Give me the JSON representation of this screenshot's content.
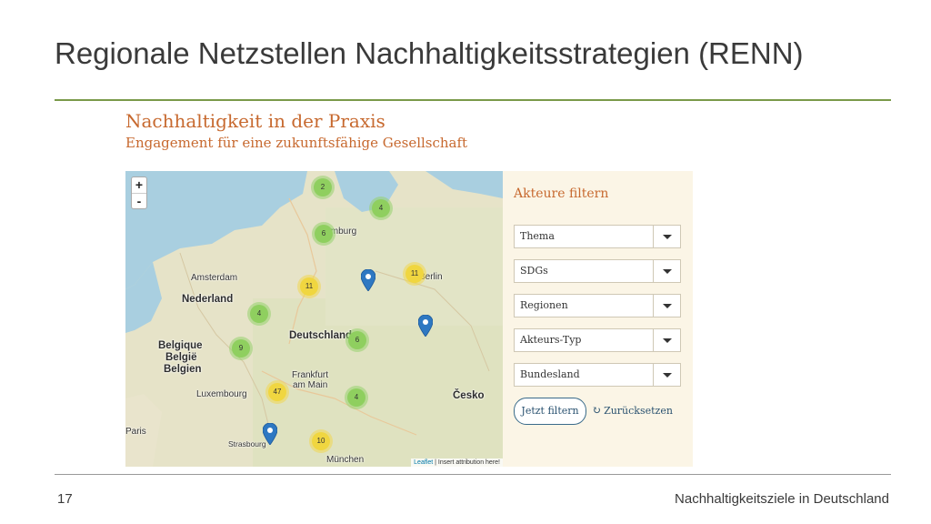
{
  "slide": {
    "title": "Regionale Netzstellen Nachhaltigkeitsstrategien (RENN)",
    "page_number": "17",
    "footer": "Nachhaltigkeitsziele in Deutschland"
  },
  "screenshot": {
    "title": "Nachhaltigkeit in der Praxis",
    "subtitle": "Engagement für eine zukunftsfähige Gesellschaft"
  },
  "map": {
    "zoom_in": "+",
    "zoom_out": "-",
    "attribution_leaflet": "Leaflet",
    "attribution_rest": "| Insert attribution here!",
    "clusters": [
      {
        "count": "2",
        "color": "green"
      },
      {
        "count": "4",
        "color": "green"
      },
      {
        "count": "6",
        "color": "green"
      },
      {
        "count": "11",
        "color": "yellow"
      },
      {
        "count": "11",
        "color": "yellow"
      },
      {
        "count": "4",
        "color": "green"
      },
      {
        "count": "6",
        "color": "green"
      },
      {
        "count": "9",
        "color": "green"
      },
      {
        "count": "47",
        "color": "yellow"
      },
      {
        "count": "4",
        "color": "green"
      },
      {
        "count": "10",
        "color": "yellow"
      }
    ],
    "labels": {
      "hamburg": "Hamburg",
      "berlin": "Berlin",
      "amsterdam": "Amsterdam",
      "nederland": "Nederland",
      "deutschland": "Deutschland",
      "belgique_1": "Belgique",
      "belgique_2": "België",
      "belgique_3": "Belgien",
      "frankfurt_1": "Frankfurt",
      "frankfurt_2": "am Main",
      "luxembourg": "Luxembourg",
      "cesko": "Česko",
      "paris": "Paris",
      "strasbourg": "Strasbourg",
      "muenchen": "München"
    },
    "colors": {
      "cluster_green": "#8fcf5f",
      "cluster_yellow": "#f0d640",
      "pin": "#2e78c2",
      "water": "#a9cfe0"
    }
  },
  "filters": {
    "title": "Akteure filtern",
    "selects": [
      {
        "label": "Thema"
      },
      {
        "label": "SDGs"
      },
      {
        "label": "Regionen"
      },
      {
        "label": "Akteurs-Typ"
      },
      {
        "label": "Bundesland"
      }
    ],
    "apply_button": "Jetzt filtern",
    "reset_button": "Zurücksetzen"
  }
}
